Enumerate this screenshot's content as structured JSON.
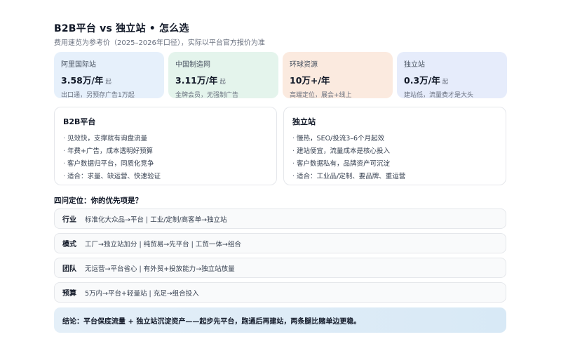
{
  "header": {
    "title": "B2B平台 vs 独立站 • 怎么选",
    "subtitle": "费用速览为参考价（2025–2026年口径），实际以平台官方报价为准"
  },
  "price_cards": [
    {
      "name": "阿里国际站",
      "price": "3.58万/年",
      "unit": "起",
      "note": "出口通，另预存广告1万起",
      "bg": "#e6f0fb"
    },
    {
      "name": "中国制造网",
      "price": "3.11万/年",
      "unit": "起",
      "note": "金牌会员，无强制广告",
      "bg": "#e4f4ec"
    },
    {
      "name": "环球资源",
      "price": "10万+/年",
      "unit": "",
      "note": "高端定位，展会+线上",
      "bg": "#fbeadf"
    },
    {
      "name": "独立站",
      "price": "0.3万/年",
      "unit": "起",
      "note": "建站低，流量费才是大头",
      "bg": "#e6ecfb"
    }
  ],
  "compare": {
    "b2b": {
      "title": "B2B平台",
      "items": [
        "见效快，支撑就有询盘流量",
        "年费+广告，成本透明好预算",
        "客户数据归平台，同质化竞争",
        "适合：求量、缺运营、快速验证"
      ]
    },
    "site": {
      "title": "独立站",
      "items": [
        "慢热，SEO/投流3–6个月起效",
        "建站便宜，流量成本是核心投入",
        "客户数据私有，品牌资产可沉淀",
        "适合：工业品/定制、要品牌、重运营"
      ]
    }
  },
  "positioning": {
    "heading": "四问定位：你的优先项是？",
    "rows": [
      {
        "label": "行业",
        "text": "标准化大众品→平台 | 工业/定制/高客单→独立站"
      },
      {
        "label": "模式",
        "text": "工厂→独立站加分 | 纯贸易→先平台 | 工贸一体→组合"
      },
      {
        "label": "团队",
        "text": "无运营→平台省心 | 有外贸+投放能力→独立站放量"
      },
      {
        "label": "预算",
        "text": "5万内→平台+轻量站 | 充足→组合投入"
      }
    ]
  },
  "conclusion": {
    "label": "结论：",
    "text": "平台保底流量 + 独立站沉淀资产——起步先平台，跑通后再建站，两条腿比赌单边更稳。"
  }
}
